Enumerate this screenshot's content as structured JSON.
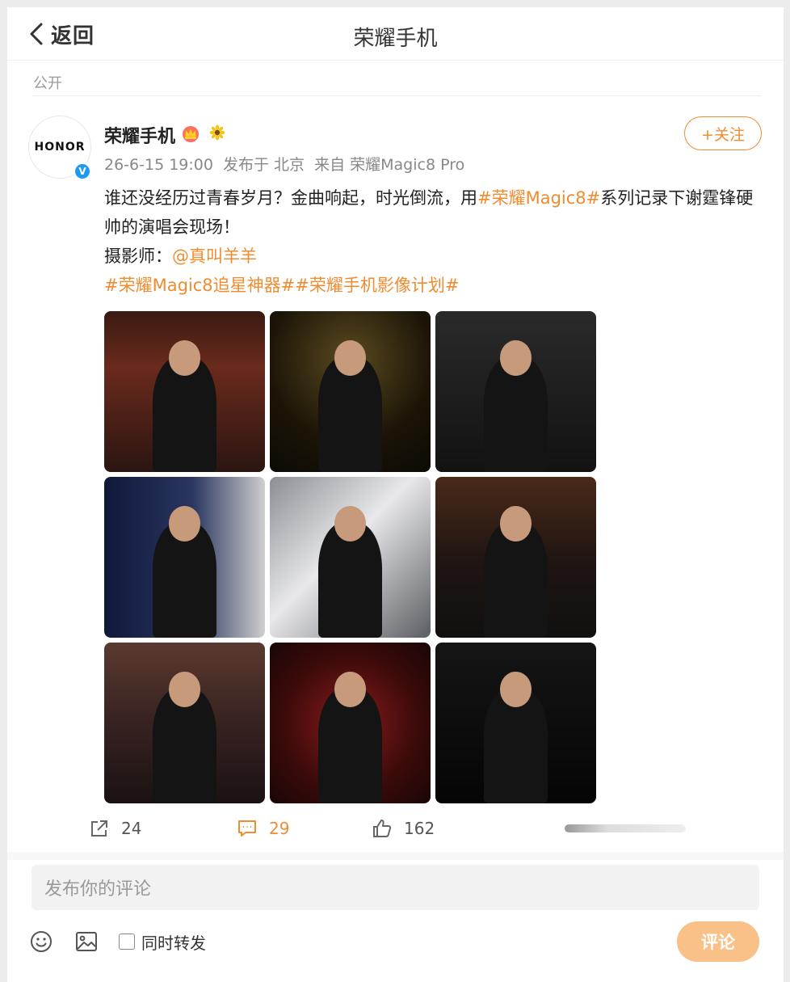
{
  "header": {
    "back_label": "返回",
    "title": "荣耀手机"
  },
  "visibility": "公开",
  "post": {
    "author": {
      "name": "荣耀手机",
      "avatar_text": "HONOR",
      "verified_icon": "V"
    },
    "meta": {
      "time": "26-6-15 19:00",
      "location": "发布于 北京",
      "source": "来自 荣耀Magic8 Pro"
    },
    "follow_label": "+关注",
    "text": {
      "part1": "谁还没经历过青春岁月？金曲响起，时光倒流，用",
      "tag1": "#荣耀Magic8#",
      "part2": "系列记录下谢霆锋硬帅的演唱会现场！",
      "photographer_label": "摄影师：",
      "mention": "@真叫羊羊",
      "tag2": "#荣耀Magic8追星神器#",
      "tag3": "#荣耀手机影像计划#"
    },
    "photos_count": 9,
    "stats": {
      "reposts": "24",
      "comments": "29",
      "likes": "162"
    }
  },
  "composer": {
    "placeholder": "发布你的评论",
    "repost_checkbox_label": "同时转发",
    "submit_label": "评论"
  },
  "colors": {
    "accent": "#f08c30",
    "submit_bg": "#f9c087",
    "verified": "#1d9bf0"
  }
}
